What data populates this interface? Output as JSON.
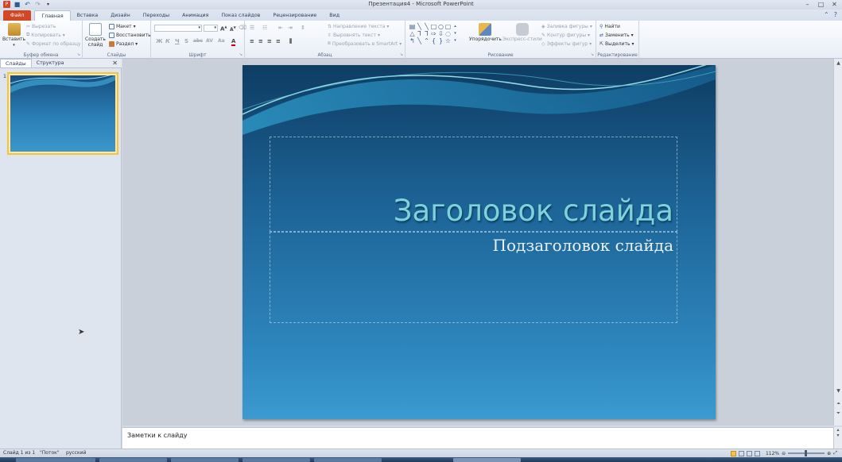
{
  "window": {
    "title": "Презентация4 - Microsoft PowerPoint"
  },
  "ribbon_tabs": [
    {
      "label": "Файл"
    },
    {
      "label": "Главная"
    },
    {
      "label": "Вставка"
    },
    {
      "label": "Дизайн"
    },
    {
      "label": "Переходы"
    },
    {
      "label": "Анимация"
    },
    {
      "label": "Показ слайдов"
    },
    {
      "label": "Рецензирование"
    },
    {
      "label": "Вид"
    }
  ],
  "ribbon": {
    "clipboard": {
      "paste": "Вставить",
      "cut": "Вырезать",
      "copy": "Копировать",
      "format_painter": "Формат по образцу",
      "label": "Буфер обмена"
    },
    "slides": {
      "new_slide": "Создать слайд",
      "layout": "Макет",
      "reset": "Восстановить",
      "section": "Раздел",
      "label": "Слайды"
    },
    "font": {
      "label": "Шрифт",
      "font_name": "",
      "font_size": ""
    },
    "paragraph": {
      "text_direction": "Направление текста",
      "align_text": "Выровнять текст",
      "smartart": "Преобразовать в SmartArt",
      "label": "Абзац"
    },
    "drawing": {
      "arrange": "Упорядочить",
      "quick_styles": "Экспресс-стили",
      "shape_fill": "Заливка фигуры",
      "shape_outline": "Контур фигуры",
      "shape_effects": "Эффекты фигур",
      "label": "Рисование"
    },
    "editing": {
      "find": "Найти",
      "replace": "Заменить",
      "select": "Выделить",
      "label": "Редактирование"
    }
  },
  "left_pane": {
    "tab_slides": "Слайды",
    "tab_outline": "Структура",
    "slide_number": "1"
  },
  "slide": {
    "title": "Заголовок слайда",
    "subtitle": "Подзаголовок слайда"
  },
  "notes": {
    "placeholder": "Заметки к слайду"
  },
  "status": {
    "slide_info": "Слайд 1 из 1",
    "theme": "\"Поток\"",
    "language": "русский",
    "zoom": "112%"
  },
  "colors": {
    "file_tab": "#d24726",
    "slide_top": "#0e3d63",
    "slide_bottom": "#3b9ad0",
    "title_text": "#7fd2d9",
    "thumb_highlight": "#f5c342"
  }
}
